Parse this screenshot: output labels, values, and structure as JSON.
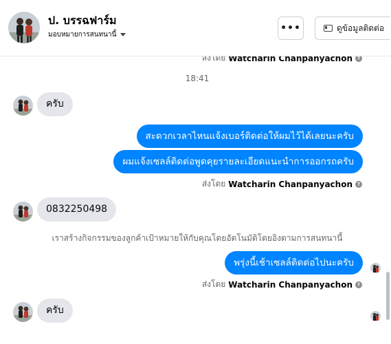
{
  "header": {
    "contact_name": "ป. บรรฉฟาร์ม",
    "assign_label": "มอบหมายการสนทนานี้",
    "more_label": "•••",
    "contact_info_label": "ดูข้อมูลติดต่อ"
  },
  "thread": {
    "top_sent_by": {
      "prefix": "ส่งโดย",
      "name": "Watcharin Chanpanyachon"
    },
    "timestamp": "18:41",
    "incoming_1": "ครับ",
    "outgoing_1": "สะดวกเวลาไหนแจ้งเบอร์ติดต่อให้ผมไว้ได้เลยนะครับ",
    "outgoing_2": "ผมแจ้งเซลล์ติดต่อพูดคุยรายละเอียดแนะนำการออกรถครับ",
    "sent_by_1": {
      "prefix": "ส่งโดย",
      "name": "Watcharin Chanpanyachon"
    },
    "incoming_2": "0832250498",
    "system_note": "เราสร้างกิจกรรมของลูกค้าเป้าหมายให้กับคุณโดยอัตโนมัติโดยอิงตามการสนทนานี้",
    "outgoing_3": "พรุ่งนี้เช้าเซลล์ติดต่อไปนะครับ",
    "sent_by_2": {
      "prefix": "ส่งโดย",
      "name": "Watcharin Chanpanyachon"
    },
    "incoming_3": "ครับ"
  },
  "colors": {
    "outgoing_bubble": "#0084ff",
    "incoming_bubble": "#e4e6eb",
    "muted_text": "#65676b"
  },
  "icons": [
    "avatar",
    "caret-down-icon",
    "more-icon",
    "id-card-icon",
    "info-icon",
    "read-receipt-avatar"
  ]
}
